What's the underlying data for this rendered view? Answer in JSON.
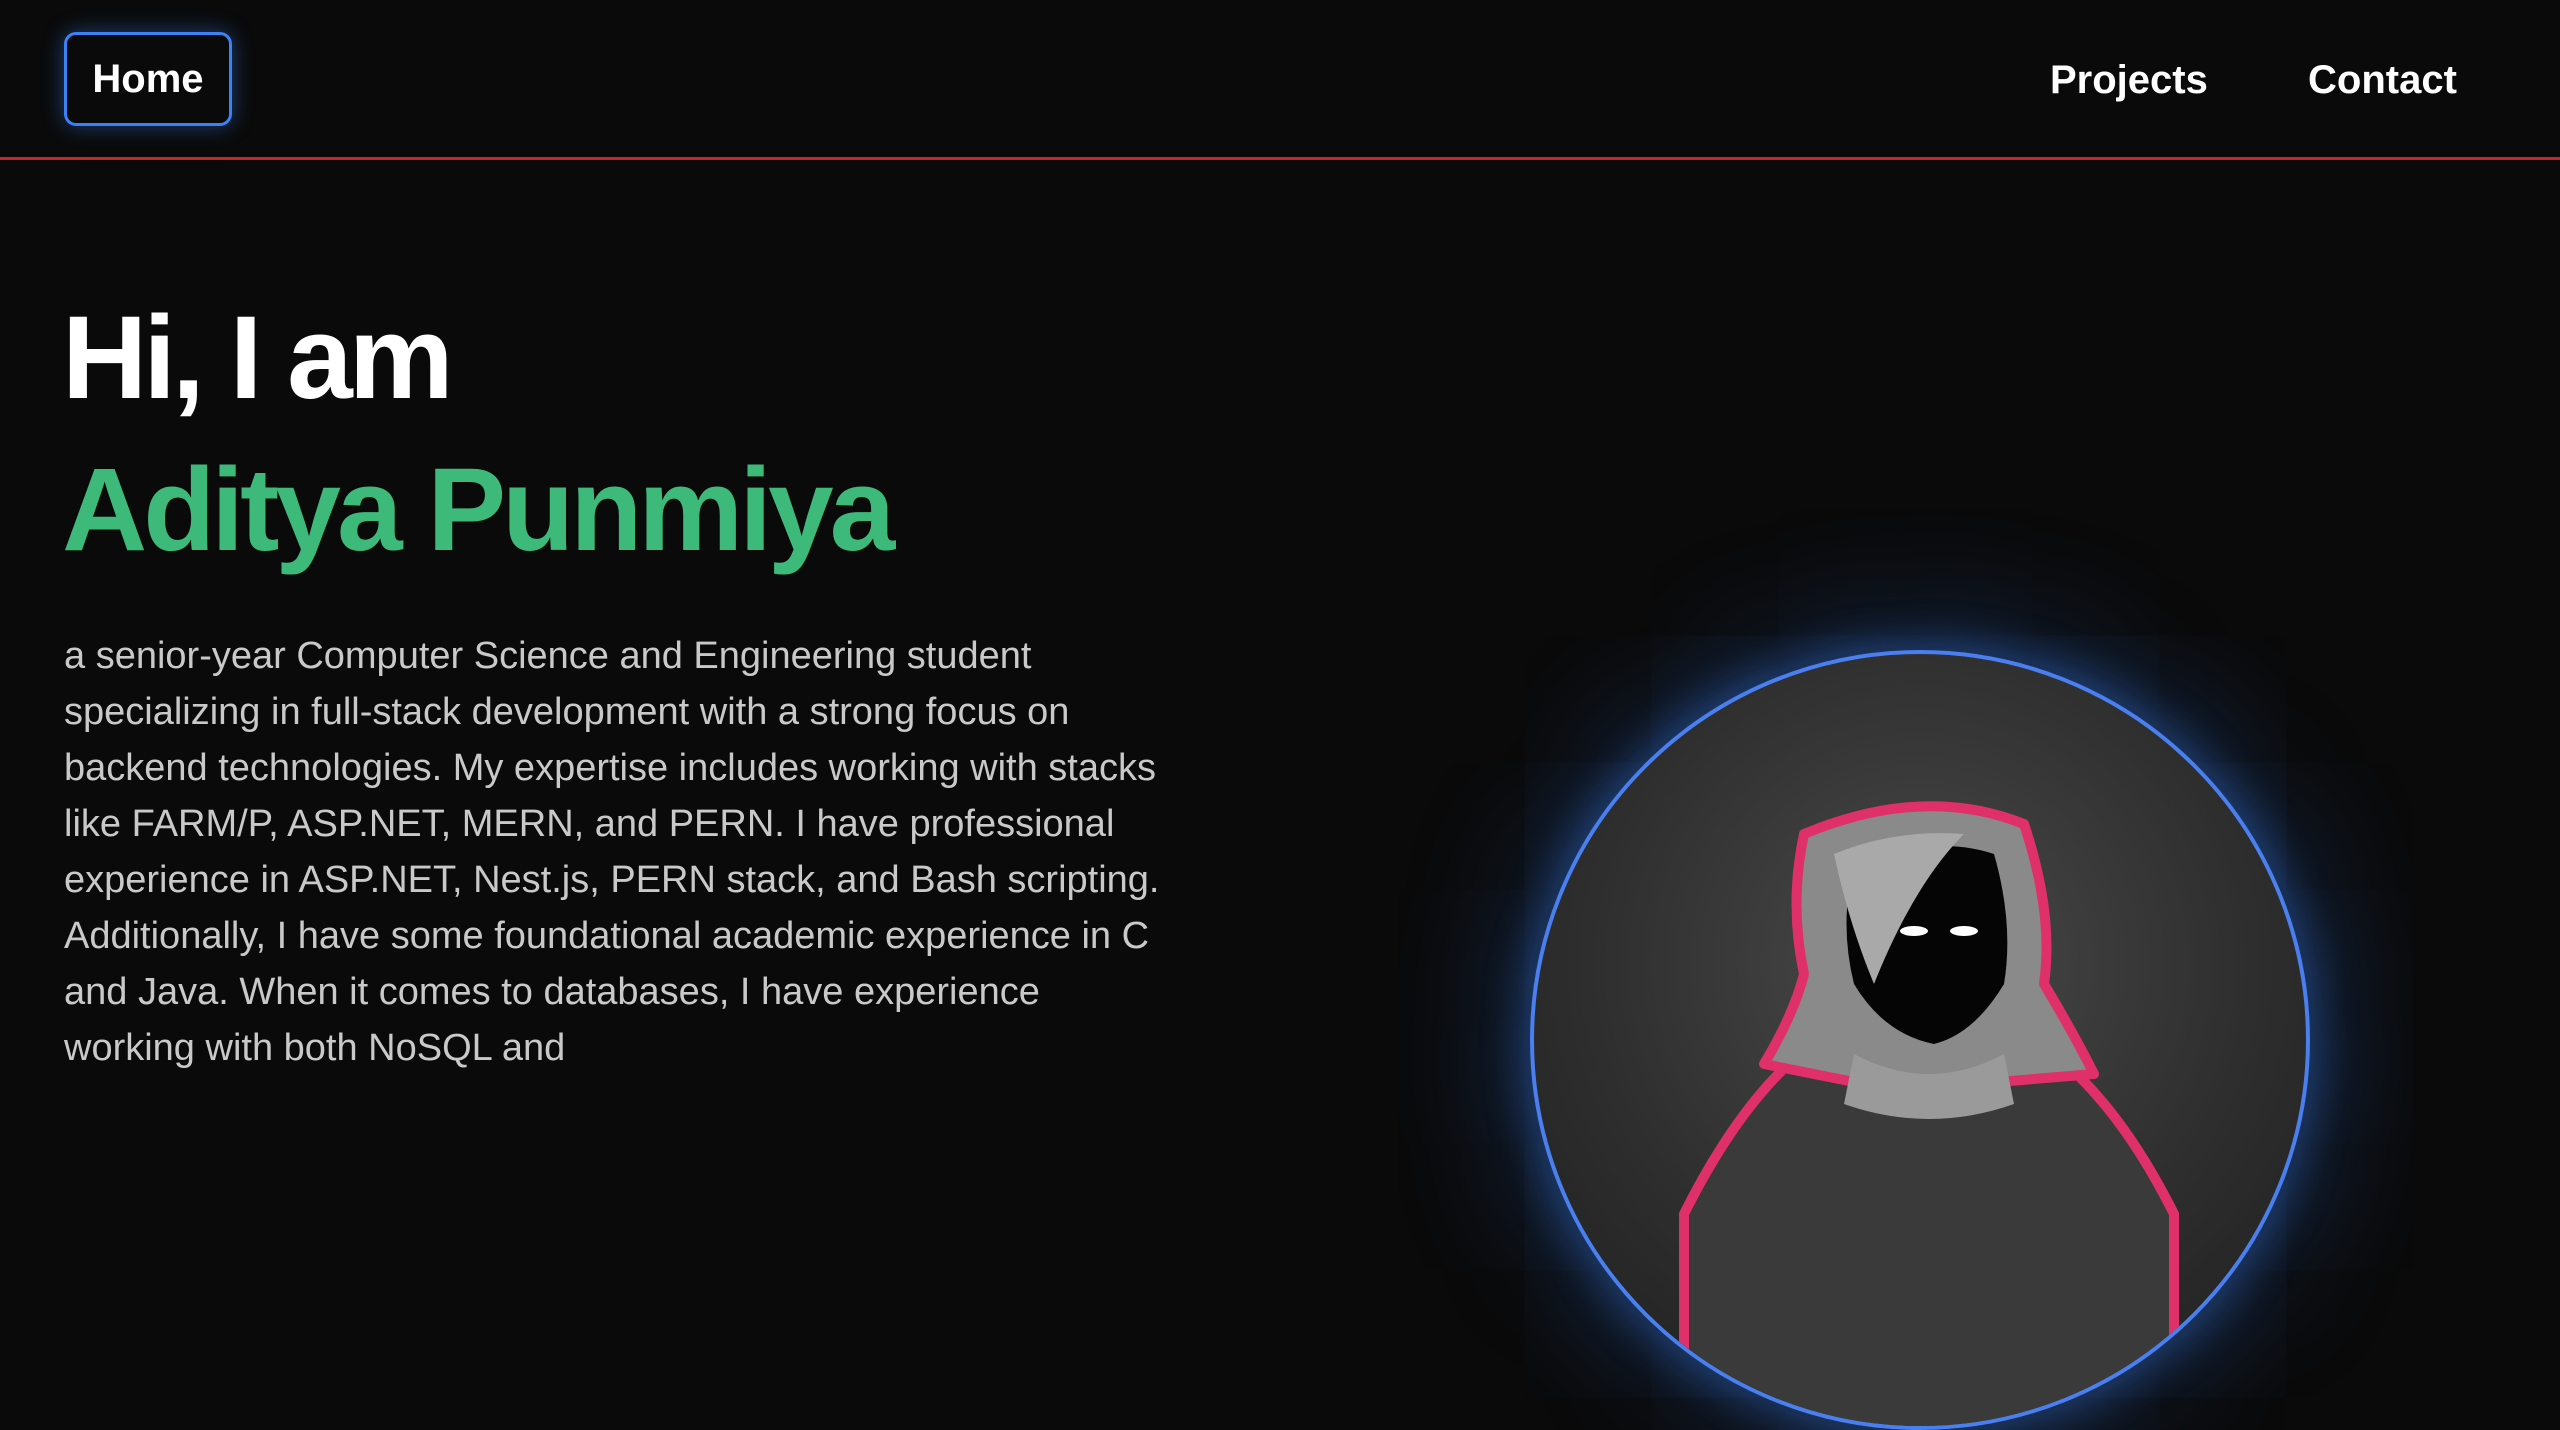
{
  "nav": {
    "home_label": "Home",
    "projects_label": "Projects",
    "contact_label": "Contact",
    "active_border_color": "#3b82f6",
    "divider_color": "#c62828"
  },
  "hero": {
    "greeting": "Hi, I am",
    "name": "Aditya Punmiya",
    "name_color": "#3dba7a",
    "bio": "a senior-year Computer Science and Engineering student specializing in full-stack development with a strong focus on backend technologies. My expertise includes working with stacks like FARM/P, ASP.NET, MERN, and PERN. I have professional experience in ASP.NET, Nest.js, PERN stack, and Bash scripting. Additionally, I have some foundational academic experience in C and Java. When it comes to databases, I have experience working with both NoSQL and"
  },
  "avatar": {
    "icon": "hooded-figure-icon",
    "ring_color": "#4a7ff0",
    "outline_color": "#e0306a"
  }
}
